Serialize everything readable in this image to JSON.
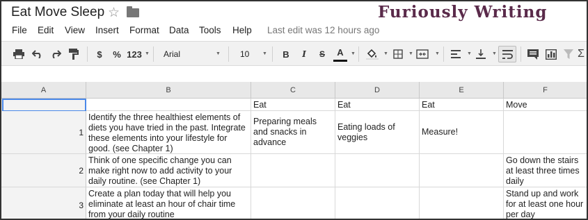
{
  "document": {
    "title": "Eat Move Sleep",
    "watermark": "Furiously Writing"
  },
  "menu": {
    "items": [
      "File",
      "Edit",
      "View",
      "Insert",
      "Format",
      "Data",
      "Tools",
      "Help"
    ],
    "last_edit": "Last edit was 12 hours ago"
  },
  "toolbar": {
    "currency": "$",
    "percent": "%",
    "more_formats": "123",
    "font": "Arial",
    "font_size": "10",
    "bold": "B",
    "italic": "I",
    "strikethrough": "S",
    "text_color": "A"
  },
  "sheet": {
    "columns": [
      "A",
      "B",
      "C",
      "D",
      "E",
      "F"
    ],
    "header_row": {
      "A": "",
      "B": "",
      "C": "Eat",
      "D": "Eat",
      "E": "Eat",
      "F": "Move"
    },
    "rows": [
      {
        "num": "1",
        "B": "Identify the three healthiest elements of diets you have tried in the past. Integrate these elements into your lifestyle for good. (see Chapter 1)",
        "C": "Preparing meals and snacks in advance",
        "D": "Eating loads of veggies",
        "E": "Measure!",
        "F": ""
      },
      {
        "num": "2",
        "B": "Think of one specific change you can make right now to add activity to your daily routine. (see Chapter 1)",
        "C": "",
        "D": "",
        "E": "",
        "F": "Go down the stairs at least three times daily"
      },
      {
        "num": "3",
        "B": "Create a plan today that will help you eliminate at least an hour of chair time from your daily routine",
        "C": "",
        "D": "",
        "E": "",
        "F": "Stand up and work for at least one hour per day"
      }
    ]
  },
  "colors": {
    "selection": "#4a88e8",
    "header_bg": "#e8e8e8",
    "toolbar_bg": "#f1f1f1",
    "watermark": "#5a2a4a"
  }
}
